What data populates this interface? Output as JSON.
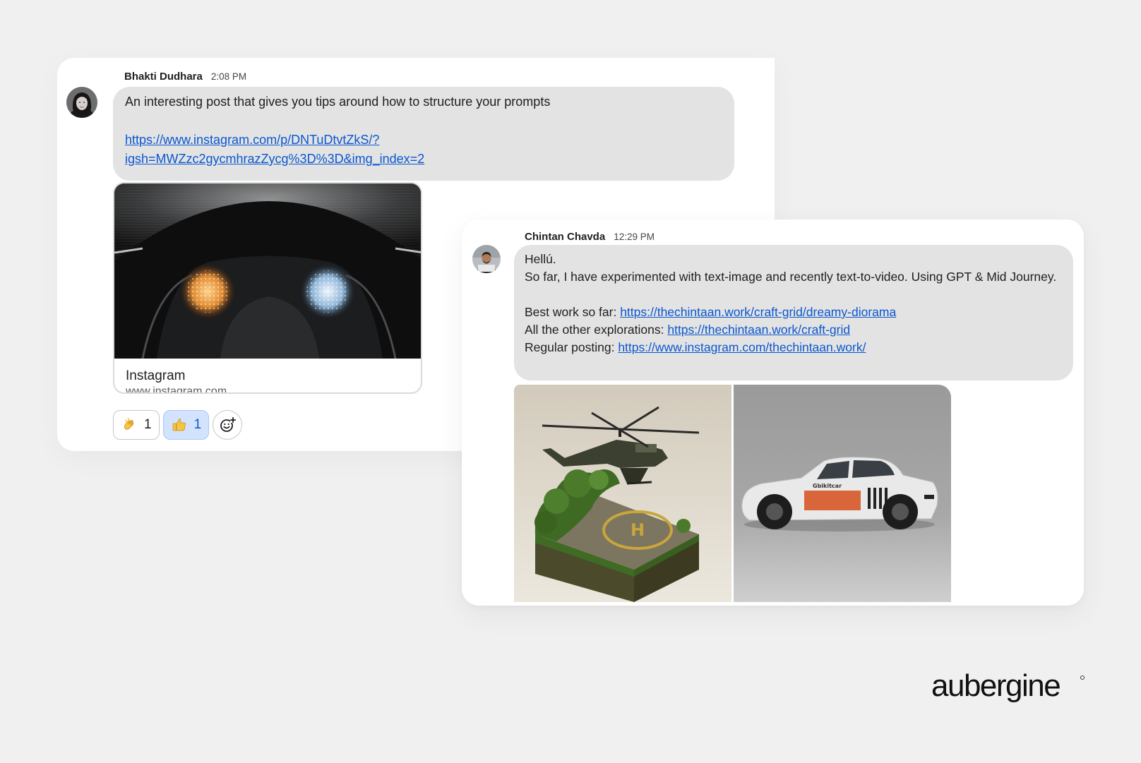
{
  "message_1": {
    "sender": "Bhakti Dudhara",
    "time": "2:08 PM",
    "text": "An interesting post that gives you tips around how to structure your prompts",
    "link_line_1": "https://www.instagram.com/p/DNTuDtvtZkS/?",
    "link_line_2": "igsh=MWZzc2gycmhrazZycg%3D%3D&img_index=2",
    "preview": {
      "title": "Instagram",
      "domain": "www.instagram.com"
    },
    "reactions": [
      {
        "emoji": "clapping-hands",
        "count": "1",
        "active": false
      },
      {
        "emoji": "thumbs-up",
        "count": "1",
        "active": true
      }
    ]
  },
  "message_2": {
    "sender": "Chintan Chavda",
    "time": "12:29 PM",
    "greeting": "Hellú.",
    "body": "So far, I have experimented with text-image and recently text-to-video. Using GPT & Mid Journey.",
    "best_work_label": "Best work so far: ",
    "best_work_link": "https://thechintaan.work/craft-grid/dreamy-diorama",
    "other_label": "All the other explorations: ",
    "other_link": "https://thechintaan.work/craft-grid",
    "posting_label": "Regular posting: ",
    "posting_link": "https://www.instagram.com/thechintaan.work/",
    "images": [
      "helicopter-diorama-image",
      "race-car-image"
    ]
  },
  "brand": {
    "name": "aubergine",
    "color": "#111111"
  },
  "colors": {
    "background": "#f0f0f0",
    "bubble": "#e3e3e3",
    "link": "#0b57d0",
    "active_reaction": "#d3e3fd"
  }
}
